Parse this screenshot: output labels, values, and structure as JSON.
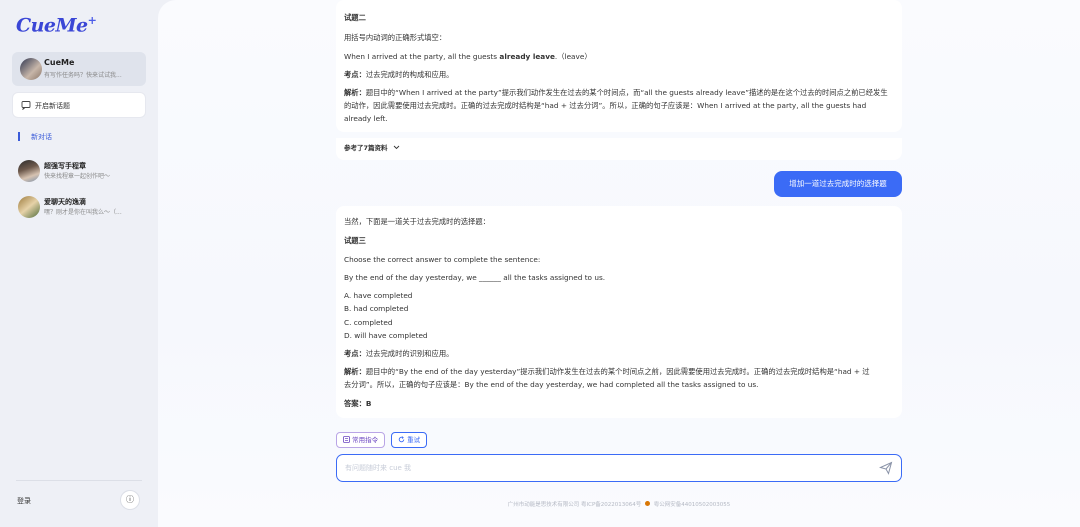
{
  "sidebar": {
    "logo_text": "CueMe",
    "logo_mark": "+",
    "assistant": {
      "name": "CueMe",
      "subtitle": "有写作任务吗？快来试试我..."
    },
    "new_chat_label": "开启新话题",
    "section_label": "新对话",
    "chats": [
      {
        "title": "超强写手程章",
        "subtitle": "快来找程章一起创作吧～"
      },
      {
        "title": "爱聊天的逸滴",
        "subtitle": "嘿？刚才是你在叫我么～（..."
      }
    ],
    "login_label": "登录",
    "info_icon": "ⓘ"
  },
  "conversation": {
    "msg1": {
      "title": "试题二",
      "instruction": "用括号内动词的正确形式填空：",
      "question_prefix": "When I arrived at the party, all the guests ",
      "question_bold": "already leave",
      "question_suffix": ".（leave）",
      "point_label": "考点：",
      "point_text": "过去完成时的构成和应用。",
      "analysis_label": "解析：",
      "analysis_text": "题目中的“When I arrived at the party”提示我们动作发生在过去的某个时间点，而“all the guests already leave”描述的是在这个过去的时间点之前已经发生的动作，因此需要使用过去完成时。正确的过去完成时结构是“had + 过去分词”。所以，正确的句子应该是：When I arrived at the party, all the guests had already left.",
      "refs_label": "参考了7篇资料"
    },
    "user_message": "增加一道过去完成时的选择题",
    "msg2": {
      "intro": "当然，下面是一道关于过去完成时的选择题：",
      "title": "试题三",
      "instruction": "Choose the correct answer to complete the sentence:",
      "question": "By the end of the day yesterday, we ______ all the tasks assigned to us.",
      "options": [
        "A. have completed",
        "B. had completed",
        "C. completed",
        "D. will have completed"
      ],
      "point_label": "考点：",
      "point_text": "过去完成时的识别和应用。",
      "analysis_label": "解析：",
      "analysis_text": "题目中的“By the end of the day yesterday”提示我们动作发生在过去的某个时间点之前，因此需要使用过去完成时。正确的过去完成时结构是“had + 过去分词”。所以，正确的句子应该是：By the end of the day yesterday, we had completed all the tasks assigned to us.",
      "answer_label": "答案：",
      "answer_value": "B"
    }
  },
  "actions": {
    "common_commands": "常用指令",
    "retry": "重试"
  },
  "input": {
    "placeholder": "有问题随时来 cue 我"
  },
  "footer": {
    "icp": "广州市动能是思技术有限公司 粤ICP备2022013064号",
    "police": "粤公网安备44010502003055"
  },
  "colors": {
    "accent": "#3b6bf6",
    "logo": "#3a46d6",
    "chip_purple": "#6b46c1"
  }
}
